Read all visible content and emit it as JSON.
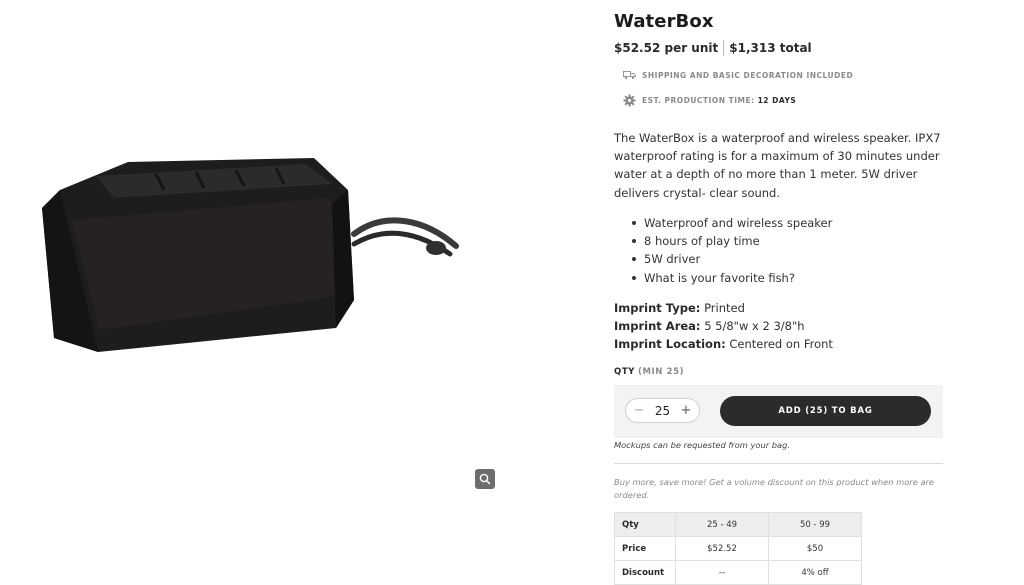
{
  "product": {
    "title": "WaterBox",
    "price_per_unit": "$52.52 per unit",
    "price_total": "$1,313 total",
    "shipping_note": "SHIPPING AND BASIC DECORATION INCLUDED",
    "production_label": "EST. PRODUCTION TIME:",
    "production_value": "12 DAYS",
    "description": "The WaterBox is a waterproof and wireless speaker.  IPX7 waterproof rating is for a maximum of 30 minutes under water at a depth of no more than 1 meter. 5W driver delivers crystal- clear sound.",
    "bullets": [
      "Waterproof and wireless speaker",
      "8 hours of play time",
      "5W driver",
      "What is your favorite fish?"
    ],
    "imprint": [
      {
        "label": "Imprint Type:",
        "value": "Printed"
      },
      {
        "label": "Imprint Area:",
        "value": "5 5/8\"w x 2 3/8\"h"
      },
      {
        "label": "Imprint Location:",
        "value": "Centered on Front"
      }
    ]
  },
  "order": {
    "qty_label": "QTY",
    "qty_min": "(MIN 25)",
    "quantity": "25",
    "decrement_symbol": "−",
    "increment_symbol": "+",
    "add_button": "ADD (25) TO BAG",
    "mockups_note": "Mockups can be requested from your bag."
  },
  "volume": {
    "note": "Buy more, save more! Get a volume discount on this product when more are ordered.",
    "headers": [
      "Qty",
      "25 - 49",
      "50 - 99"
    ],
    "rows": [
      [
        "Price",
        "$52.52",
        "$50"
      ],
      [
        "Discount",
        "--",
        "4% off"
      ]
    ]
  },
  "icons": {
    "shipping": "truck-icon",
    "production": "gear-icon",
    "zoom": "magnifier-icon"
  }
}
